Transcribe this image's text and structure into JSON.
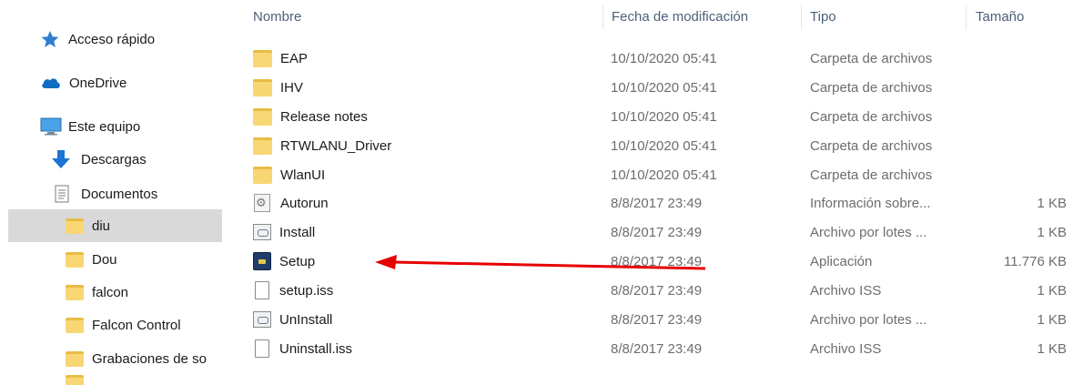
{
  "sidebar": {
    "items": [
      {
        "label": "Acceso rápido",
        "icon": "star-icon"
      },
      {
        "label": "OneDrive",
        "icon": "cloud-icon"
      },
      {
        "label": "Este equipo",
        "icon": "computer-icon"
      },
      {
        "label": "Descargas",
        "icon": "download-arrow-icon"
      },
      {
        "label": "Documentos",
        "icon": "document-icon"
      },
      {
        "label": "diu",
        "icon": "folder-icon"
      },
      {
        "label": "Dou",
        "icon": "folder-icon"
      },
      {
        "label": "falcon",
        "icon": "folder-icon"
      },
      {
        "label": "Falcon Control",
        "icon": "folder-icon"
      },
      {
        "label": "Grabaciones de so",
        "icon": "folder-icon"
      }
    ]
  },
  "columns": {
    "name": "Nombre",
    "date": "Fecha de modificación",
    "type": "Tipo",
    "size": "Tamaño"
  },
  "files": [
    {
      "name": "EAP",
      "date": "10/10/2020 05:41",
      "type": "Carpeta de archivos",
      "size": "",
      "icon": "folder-icon"
    },
    {
      "name": "IHV",
      "date": "10/10/2020 05:41",
      "type": "Carpeta de archivos",
      "size": "",
      "icon": "folder-icon"
    },
    {
      "name": "Release notes",
      "date": "10/10/2020 05:41",
      "type": "Carpeta de archivos",
      "size": "",
      "icon": "folder-icon"
    },
    {
      "name": "RTWLANU_Driver",
      "date": "10/10/2020 05:41",
      "type": "Carpeta de archivos",
      "size": "",
      "icon": "folder-icon"
    },
    {
      "name": "WlanUI",
      "date": "10/10/2020 05:41",
      "type": "Carpeta de archivos",
      "size": "",
      "icon": "folder-icon"
    },
    {
      "name": "Autorun",
      "date": "8/8/2017 23:49",
      "type": "Información sobre...",
      "size": "1 KB",
      "icon": "setup-info-icon"
    },
    {
      "name": "Install",
      "date": "8/8/2017 23:49",
      "type": "Archivo por lotes ...",
      "size": "1 KB",
      "icon": "batch-file-icon"
    },
    {
      "name": "Setup",
      "date": "8/8/2017 23:49",
      "type": "Aplicación",
      "size": "11.776 KB",
      "icon": "application-icon"
    },
    {
      "name": "setup.iss",
      "date": "8/8/2017 23:49",
      "type": "Archivo ISS",
      "size": "1 KB",
      "icon": "blank-file-icon"
    },
    {
      "name": "UnInstall",
      "date": "8/8/2017 23:49",
      "type": "Archivo por lotes ...",
      "size": "1 KB",
      "icon": "batch-file-icon"
    },
    {
      "name": "Uninstall.iss",
      "date": "8/8/2017 23:49",
      "type": "Archivo ISS",
      "size": "1 KB",
      "icon": "blank-file-icon"
    }
  ],
  "annotation": {
    "color": "#e60000",
    "points_to": "Setup"
  }
}
